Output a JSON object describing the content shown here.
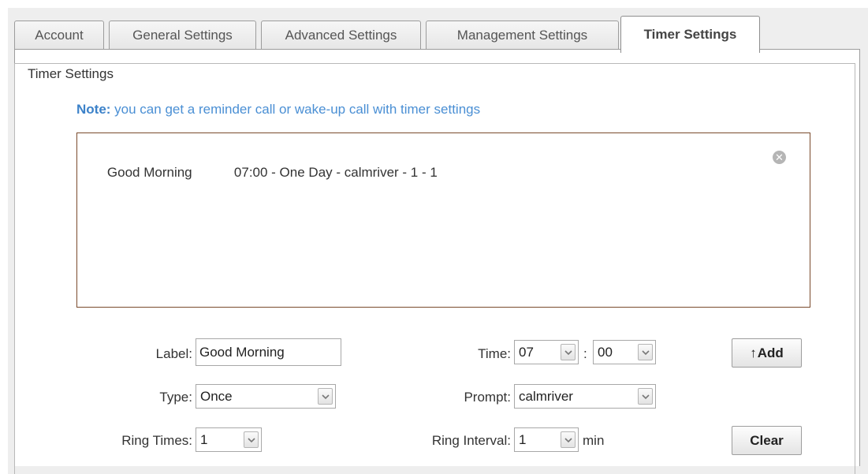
{
  "tabs": [
    {
      "label": "Account",
      "active": false
    },
    {
      "label": "General Settings",
      "active": false
    },
    {
      "label": "Advanced Settings",
      "active": false
    },
    {
      "label": "Management Settings",
      "active": false
    },
    {
      "label": "Timer Settings",
      "active": true
    }
  ],
  "section": {
    "legend": "Timer Settings",
    "note_prefix": "Note:",
    "note_text": " you can get a reminder call or wake-up call with timer settings"
  },
  "timer_list": [
    {
      "label": "Good Morning",
      "detail": "07:00 - One Day - calmriver - 1 - 1"
    }
  ],
  "form": {
    "label_caption": "Label:",
    "label_value": "Good Morning",
    "time_caption": "Time:",
    "hour": "07",
    "time_sep": ":",
    "minute": "00",
    "add_arrow": "↑",
    "add_label": "Add",
    "type_caption": "Type:",
    "type_value": "Once",
    "prompt_caption": "Prompt:",
    "prompt_value": "calmriver",
    "ring_times_caption": "Ring Times:",
    "ring_times_value": "1",
    "ring_interval_caption": "Ring Interval:",
    "ring_interval_value": "1",
    "interval_unit": "min",
    "clear_label": "Clear"
  },
  "colors": {
    "note": "#4a8fd4",
    "list_border": "#7a4a2c"
  }
}
